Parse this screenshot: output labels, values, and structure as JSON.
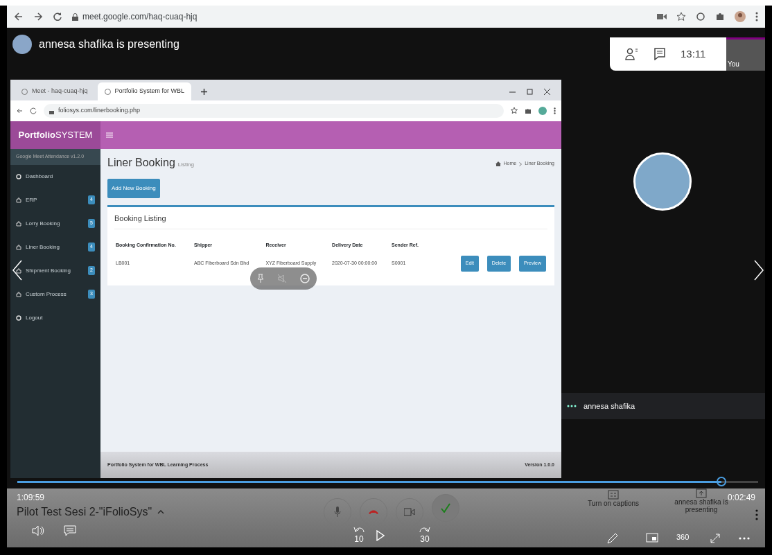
{
  "browser": {
    "url": "meet.google.com/haq-cuaq-hjq"
  },
  "meet": {
    "presenter_banner": "annesa shafika is presenting",
    "clock": "13:11",
    "self_tile_label": "You",
    "participant_name": "annesa shafika",
    "captions_label": "Turn on captions",
    "presenting_label": "annesa shafika is presenting"
  },
  "shared_browser": {
    "tabs": [
      {
        "label": "Meet - haq-cuaq-hjq",
        "selected": false
      },
      {
        "label": "Portfolio System for WBL",
        "selected": true
      }
    ],
    "url": "foliosys.com/linerbooking.php"
  },
  "app": {
    "brand": "**Portfolio**SYSTEM",
    "subtitle": "Google Meet Attendance v1.2.0",
    "sidebar": [
      {
        "label": "Dashboard",
        "kind": "link"
      },
      {
        "label": "ERP",
        "kind": "group",
        "badge": "4"
      },
      {
        "label": "Lorry Booking",
        "kind": "group",
        "badge": "5"
      },
      {
        "label": "Liner Booking",
        "kind": "group",
        "badge": "4"
      },
      {
        "label": "Shipment Booking",
        "kind": "group",
        "badge": "2"
      },
      {
        "label": "Custom Process",
        "kind": "group",
        "badge": "3"
      },
      {
        "label": "Logout",
        "kind": "link"
      }
    ],
    "page_title": "Liner Booking",
    "page_subtitle": "Listing",
    "breadcrumb": [
      "Home",
      "Liner Booking"
    ],
    "add_button": "Add New Booking",
    "card_title": "Booking Listing",
    "table": {
      "columns": [
        "Booking Confirmation No.",
        "Shipper",
        "Receiver",
        "Delivery Date",
        "Sender Ref."
      ],
      "rows": [
        {
          "cells": [
            "LB001",
            "ABC Fiberboard Sdn Bhd",
            "XYZ Fiberboard Supply",
            "2020-07-30 00:00:00",
            "S0001"
          ],
          "actions": [
            "Edit",
            "Delete",
            "Preview"
          ]
        }
      ]
    },
    "footer": {
      "left": "Portfolio System for WBL Learning Process",
      "right": "Version 1.0.0"
    }
  },
  "player": {
    "elapsed": "1:09:59",
    "title": "Pilot Test Sesi 2-\"iFolioSys\"",
    "remaining": "0:02:49",
    "progress": {
      "level": 0.95
    },
    "rewind": "10",
    "forward": "30",
    "vr": "360"
  }
}
